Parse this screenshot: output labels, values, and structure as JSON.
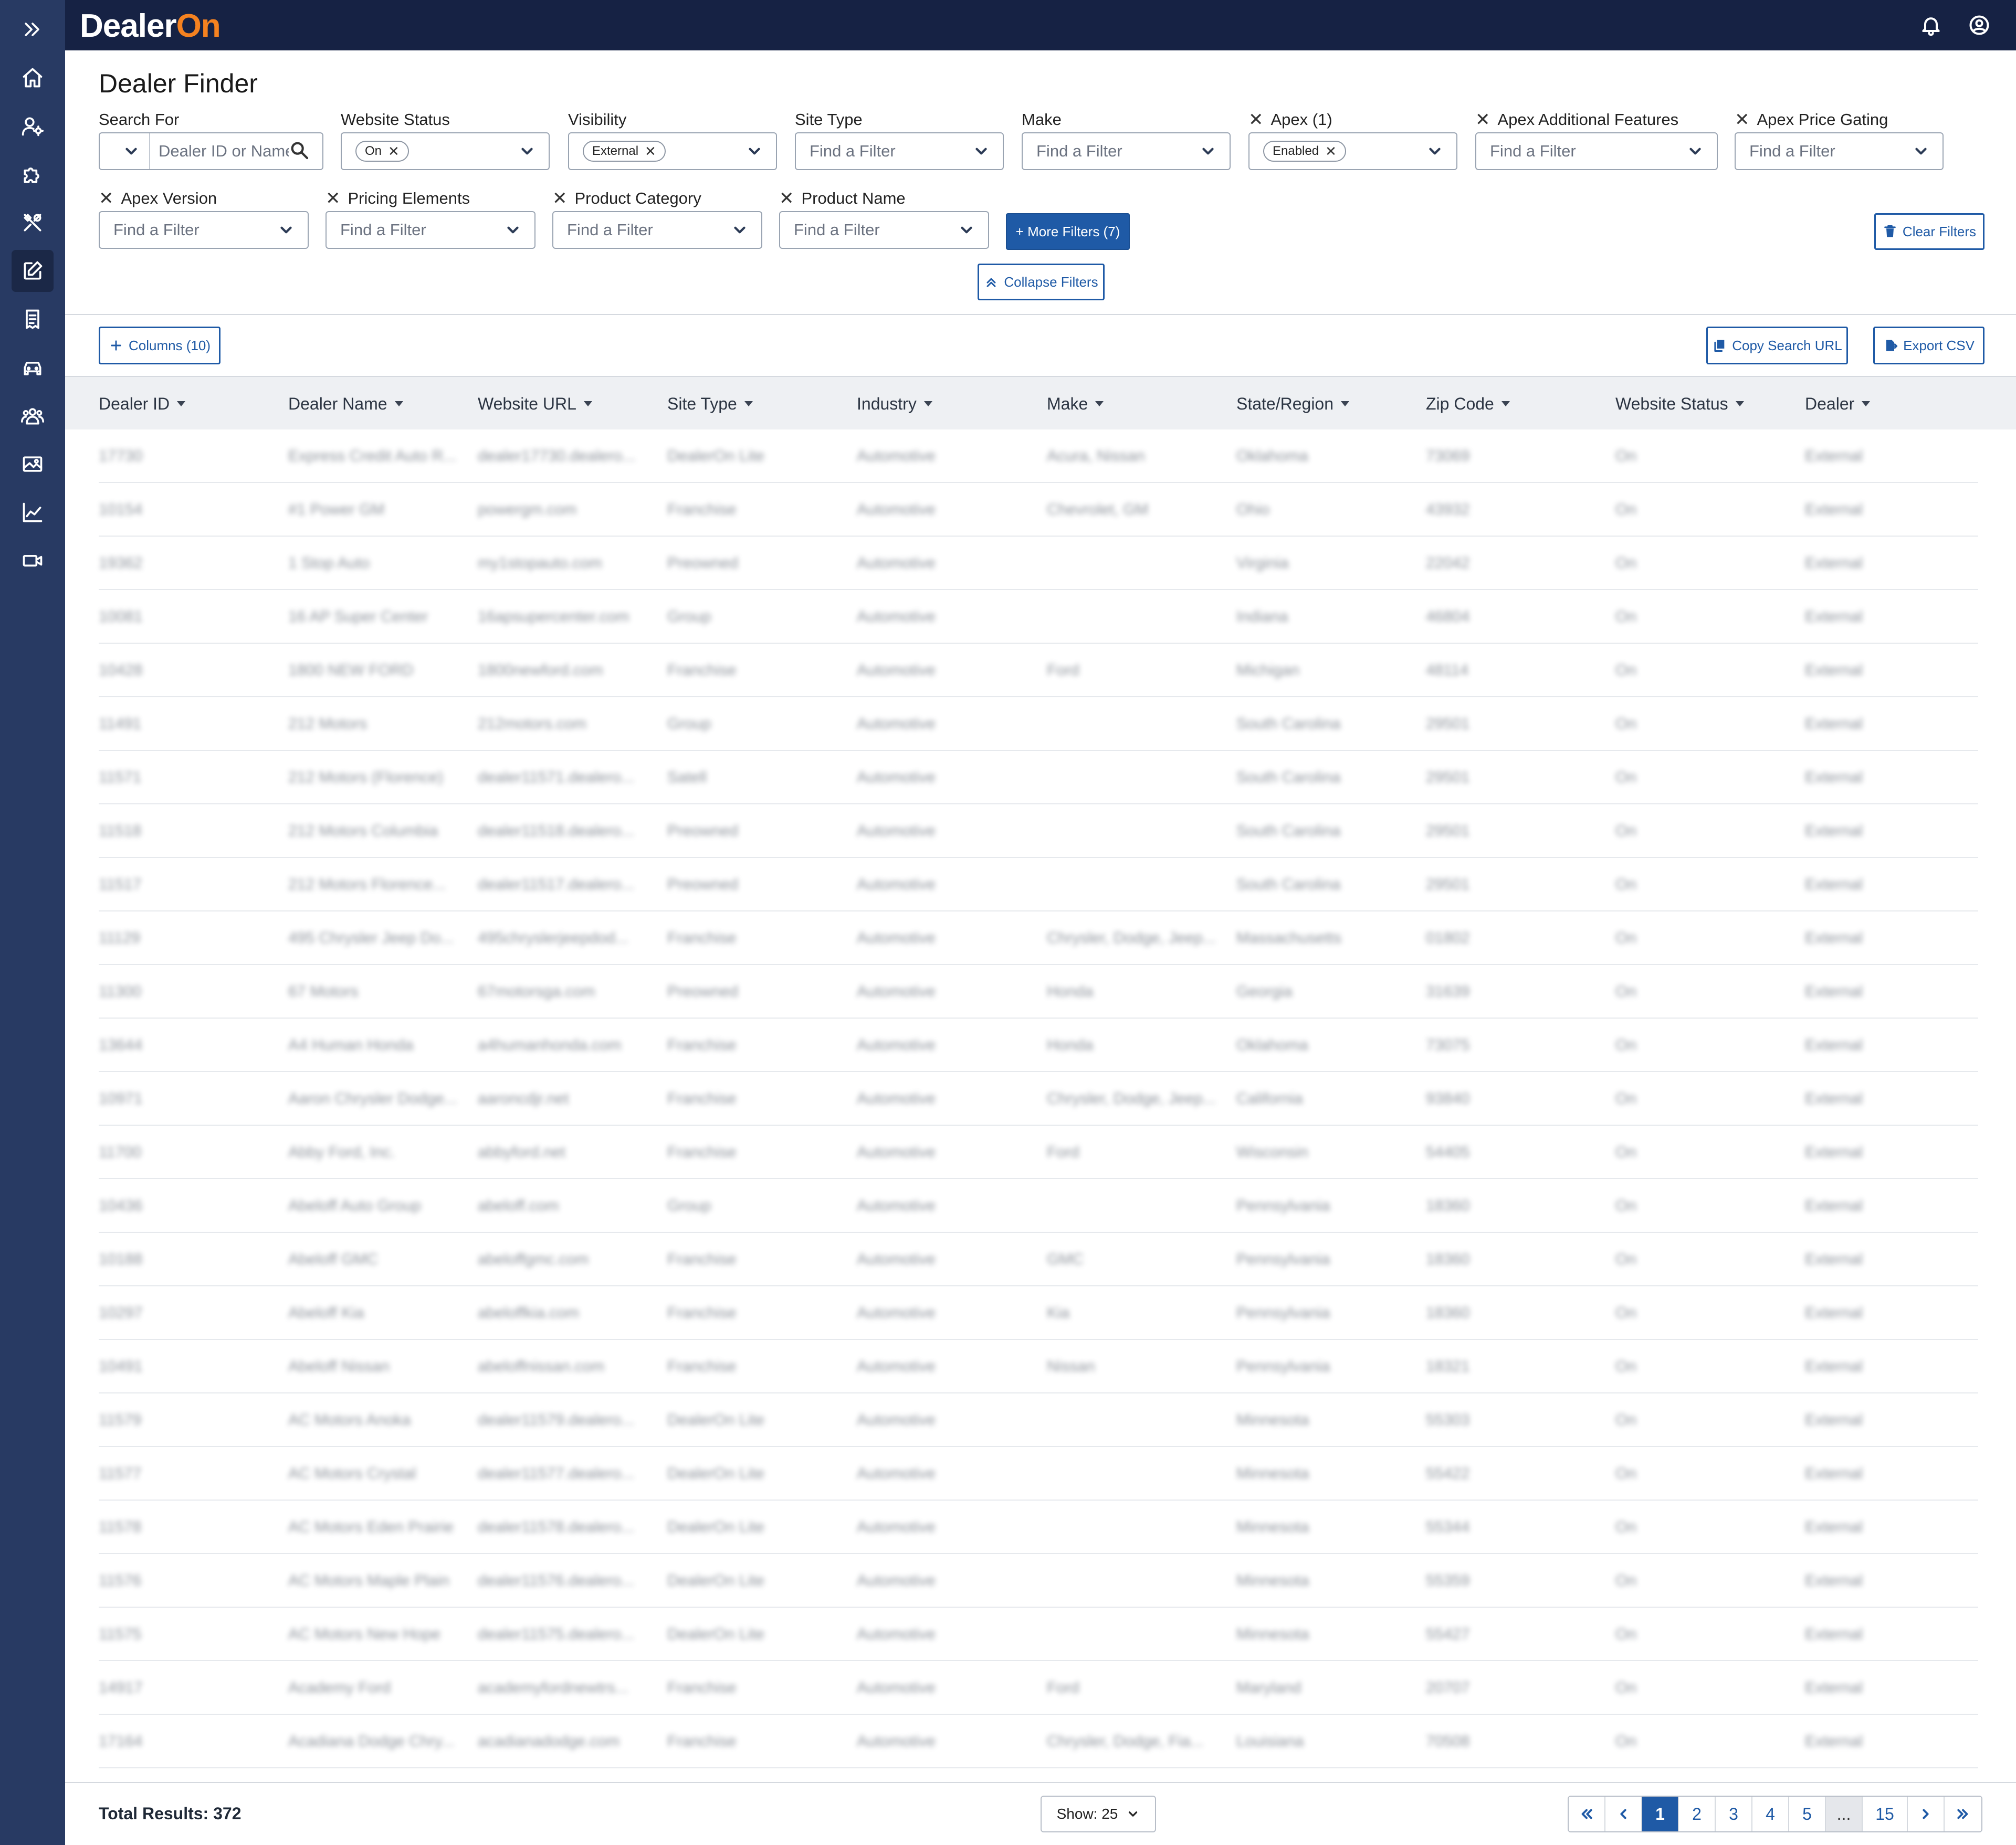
{
  "app": {
    "logo_text": "Dealer",
    "logo_on": "On"
  },
  "page": {
    "title": "Dealer Finder"
  },
  "filters": {
    "search_for": {
      "label": "Search For",
      "placeholder": "Dealer ID or Name"
    },
    "website_status": {
      "label": "Website Status",
      "chip": "On"
    },
    "visibility": {
      "label": "Visibility",
      "chip": "External"
    },
    "site_type": {
      "label": "Site Type",
      "placeholder": "Find a Filter"
    },
    "make": {
      "label": "Make",
      "placeholder": "Find a Filter"
    },
    "apex": {
      "label": "Apex (1)",
      "chip": "Enabled"
    },
    "apex_additional_features": {
      "label": "Apex Additional Features",
      "placeholder": "Find a Filter"
    },
    "apex_price_gating": {
      "label": "Apex Price Gating",
      "placeholder": "Find a Filter"
    },
    "apex_version": {
      "label": "Apex Version",
      "placeholder": "Find a Filter"
    },
    "pricing_elements": {
      "label": "Pricing Elements",
      "placeholder": "Find a Filter"
    },
    "product_category": {
      "label": "Product Category",
      "placeholder": "Find a Filter"
    },
    "product_name": {
      "label": "Product Name",
      "placeholder": "Find a Filter"
    }
  },
  "buttons": {
    "more_filters": "+ More Filters (7)",
    "clear_filters": "Clear Filters",
    "collapse_filters": "Collapse Filters",
    "columns": "Columns (10)",
    "copy_search_url": "Copy Search URL",
    "export_csv": "Export CSV"
  },
  "table": {
    "columns": [
      "Dealer ID",
      "Dealer Name",
      "Website URL",
      "Site Type",
      "Industry",
      "Make",
      "State/Region",
      "Zip Code",
      "Website Status",
      "Dealer"
    ],
    "rows": [
      [
        "17730",
        "Express Credit Auto R...",
        "dealer17730.dealero...",
        "DealerOn Lite",
        "Automotive",
        "Acura, Nissan",
        "Oklahoma",
        "73069",
        "On",
        "External"
      ],
      [
        "10154",
        "#1 Power GM",
        "powergm.com",
        "Franchise",
        "Automotive",
        "Chevrolet, GM",
        "Ohio",
        "43932",
        "On",
        "External"
      ],
      [
        "19362",
        "1 Stop Auto",
        "my1stopauto.com",
        "Preowned",
        "Automotive",
        "",
        "Virginia",
        "22042",
        "On",
        "External"
      ],
      [
        "10081",
        "16 AP Super Center",
        "16apsupercenter.com",
        "Group",
        "Automotive",
        "",
        "Indiana",
        "46804",
        "On",
        "External"
      ],
      [
        "10428",
        "1800 NEW FORD",
        "1800newford.com",
        "Franchise",
        "Automotive",
        "Ford",
        "Michigan",
        "48114",
        "On",
        "External"
      ],
      [
        "11491",
        "212 Motors",
        "212motors.com",
        "Group",
        "Automotive",
        "",
        "South Carolina",
        "29501",
        "On",
        "External"
      ],
      [
        "11571",
        "212 Motors (Florence)",
        "dealer11571.dealero...",
        "Satell",
        "Automotive",
        "",
        "South Carolina",
        "29501",
        "On",
        "External"
      ],
      [
        "11518",
        "212 Motors Columbia",
        "dealer11518.dealero...",
        "Preowned",
        "Automotive",
        "",
        "South Carolina",
        "29501",
        "On",
        "External"
      ],
      [
        "11517",
        "212 Motors Florence...",
        "dealer11517.dealero...",
        "Preowned",
        "Automotive",
        "",
        "South Carolina",
        "29501",
        "On",
        "External"
      ],
      [
        "11129",
        "495 Chrysler Jeep Do...",
        "495chryslerjeepdod...",
        "Franchise",
        "Automotive",
        "Chrysler, Dodge, Jeep...",
        "Massachusetts",
        "01802",
        "On",
        "External"
      ],
      [
        "11300",
        "67 Motors",
        "67motorsga.com",
        "Preowned",
        "Automotive",
        "Honda",
        "Georgia",
        "31639",
        "On",
        "External"
      ],
      [
        "13644",
        "A4 Human Honda",
        "a4humanhonda.com",
        "Franchise",
        "Automotive",
        "Honda",
        "Oklahoma",
        "73075",
        "On",
        "External"
      ],
      [
        "10971",
        "Aaron Chrysler Dodge...",
        "aaroncdjr.net",
        "Franchise",
        "Automotive",
        "Chrysler, Dodge, Jeep...",
        "California",
        "93840",
        "On",
        "External"
      ],
      [
        "11700",
        "Abby Ford, Inc.",
        "abbyford.net",
        "Franchise",
        "Automotive",
        "Ford",
        "Wisconsin",
        "54405",
        "On",
        "External"
      ],
      [
        "10436",
        "Abeloff Auto Group",
        "abeloff.com",
        "Group",
        "Automotive",
        "",
        "Pennsylvania",
        "18360",
        "On",
        "External"
      ],
      [
        "10188",
        "Abeloff GMC",
        "abeloffgmc.com",
        "Franchise",
        "Automotive",
        "GMC",
        "Pennsylvania",
        "18360",
        "On",
        "External"
      ],
      [
        "10297",
        "Abeloff Kia",
        "abeloffkia.com",
        "Franchise",
        "Automotive",
        "Kia",
        "Pennsylvania",
        "18360",
        "On",
        "External"
      ],
      [
        "10491",
        "Abeloff Nissan",
        "abeloffnissan.com",
        "Franchise",
        "Automotive",
        "Nissan",
        "Pennsylvania",
        "18321",
        "On",
        "External"
      ],
      [
        "11579",
        "AC Motors Anoka",
        "dealer11579.dealero...",
        "DealerOn Lite",
        "Automotive",
        "",
        "Minnesota",
        "55303",
        "On",
        "External"
      ],
      [
        "11577",
        "AC Motors Crystal",
        "dealer11577.dealero...",
        "DealerOn Lite",
        "Automotive",
        "",
        "Minnesota",
        "55422",
        "On",
        "External"
      ],
      [
        "11578",
        "AC Motors Eden Prairie",
        "dealer11578.dealero...",
        "DealerOn Lite",
        "Automotive",
        "",
        "Minnesota",
        "55344",
        "On",
        "External"
      ],
      [
        "11576",
        "AC Motors Maple Plain",
        "dealer11576.dealero...",
        "DealerOn Lite",
        "Automotive",
        "",
        "Minnesota",
        "55359",
        "On",
        "External"
      ],
      [
        "11575",
        "AC Motors New Hope",
        "dealer11575.dealero...",
        "DealerOn Lite",
        "Automotive",
        "",
        "Minnesota",
        "55427",
        "On",
        "External"
      ],
      [
        "14917",
        "Academy Ford",
        "academyfordnewtrs...",
        "Franchise",
        "Automotive",
        "Ford",
        "Maryland",
        "20707",
        "On",
        "External"
      ],
      [
        "17164",
        "Acadiana Dodge Chry...",
        "acadianadodge.com",
        "Franchise",
        "Automotive",
        "Chrysler, Dodge, Fia...",
        "Louisiana",
        "70508",
        "On",
        "External"
      ]
    ]
  },
  "footer": {
    "total": "Total Results: 372",
    "show": "Show: 25",
    "pages": [
      "1",
      "2",
      "3",
      "4",
      "5",
      "...",
      "15"
    ]
  }
}
